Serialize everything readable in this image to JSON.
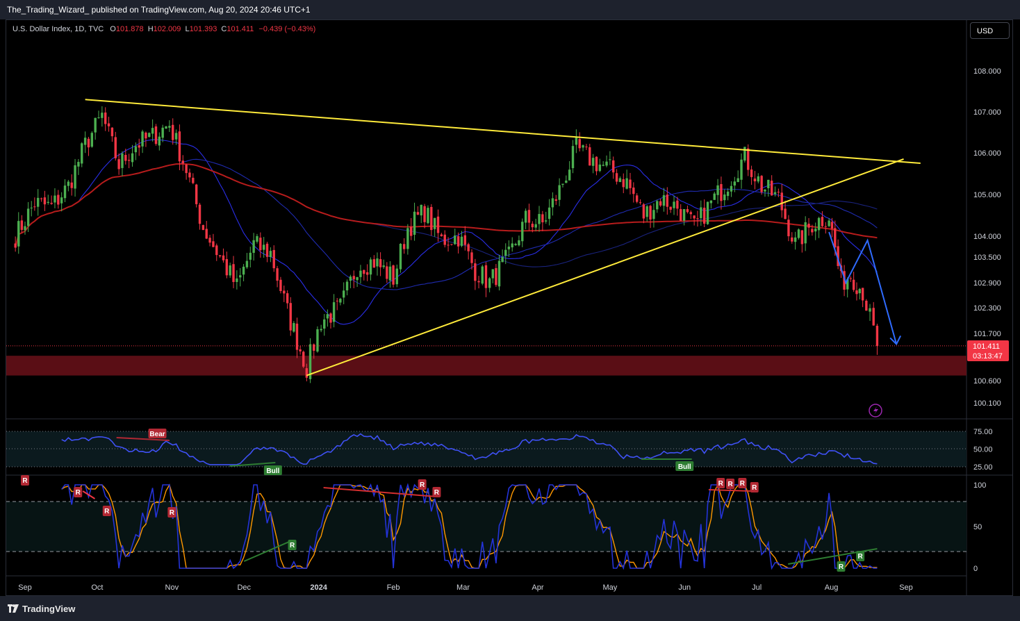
{
  "header": {
    "publisher": "The_Trading_Wizard_ published on TradingView.com, Aug 20, 2024 20:46 UTC+1"
  },
  "legend": {
    "symbol": "U.S. Dollar Index, 1D, TVC",
    "o_label": "O",
    "o_value": "101.878",
    "h_label": "H",
    "h_value": "102.009",
    "l_label": "L",
    "l_value": "101.393",
    "c_label": "C",
    "c_value": "101.411",
    "change": "−0.439 (−0.43%)"
  },
  "currency_button": "USD",
  "footer": {
    "logo_text": "TradingView"
  },
  "colors": {
    "up": "#4caf50",
    "down": "#f23645",
    "trendline": "#ffeb3b",
    "ma_red": "#b71c1c",
    "ma_blue": "#2a2ee8",
    "projection": "#2962ff",
    "zone": "#5a0e15",
    "rsi": "#3f51f5",
    "stoch_k": "#2433d8",
    "stoch_d": "#ff9800"
  },
  "chart_data": [
    {
      "type": "candlestick",
      "title": "U.S. Dollar Index, 1D, TVC",
      "x_labels": [
        "Sep",
        "Oct",
        "Nov",
        "Dec",
        "2024",
        "Feb",
        "Mar",
        "Apr",
        "May",
        "Jun",
        "Jul",
        "Aug",
        "Sep"
      ],
      "y_ticks": [
        "108.000",
        "107.000",
        "106.000",
        "105.000",
        "104.000",
        "103.500",
        "102.900",
        "102.300",
        "101.700",
        "100.600",
        "100.100"
      ],
      "last_price": "101.411",
      "countdown": "03:13:47",
      "close_path": [
        [
          "2023-08-28",
          104.0
        ],
        [
          "2023-09-05",
          104.8
        ],
        [
          "2023-09-12",
          104.7
        ],
        [
          "2023-09-19",
          105.2
        ],
        [
          "2023-09-26",
          106.2
        ],
        [
          "2023-10-03",
          106.9
        ],
        [
          "2023-10-10",
          105.7
        ],
        [
          "2023-10-17",
          106.2
        ],
        [
          "2023-10-24",
          106.4
        ],
        [
          "2023-10-31",
          106.7
        ],
        [
          "2023-11-07",
          105.6
        ],
        [
          "2023-11-14",
          104.2
        ],
        [
          "2023-11-21",
          103.5
        ],
        [
          "2023-11-28",
          102.8
        ],
        [
          "2023-12-05",
          103.8
        ],
        [
          "2023-12-12",
          103.6
        ],
        [
          "2023-12-19",
          102.2
        ],
        [
          "2023-12-27",
          100.9
        ],
        [
          "2024-01-02",
          102.0
        ],
        [
          "2024-01-10",
          102.3
        ],
        [
          "2024-01-17",
          103.3
        ],
        [
          "2024-01-24",
          103.4
        ],
        [
          "2024-02-01",
          103.0
        ],
        [
          "2024-02-07",
          104.2
        ],
        [
          "2024-02-14",
          104.6
        ],
        [
          "2024-02-21",
          103.9
        ],
        [
          "2024-02-28",
          104.0
        ],
        [
          "2024-03-06",
          103.2
        ],
        [
          "2024-03-12",
          102.9
        ],
        [
          "2024-03-20",
          103.5
        ],
        [
          "2024-03-27",
          104.4
        ],
        [
          "2024-04-03",
          104.3
        ],
        [
          "2024-04-10",
          105.1
        ],
        [
          "2024-04-17",
          106.1
        ],
        [
          "2024-04-24",
          105.8
        ],
        [
          "2024-05-01",
          105.6
        ],
        [
          "2024-05-08",
          105.3
        ],
        [
          "2024-05-15",
          104.5
        ],
        [
          "2024-05-22",
          104.9
        ],
        [
          "2024-05-29",
          104.7
        ],
        [
          "2024-06-05",
          104.2
        ],
        [
          "2024-06-12",
          104.8
        ],
        [
          "2024-06-19",
          105.3
        ],
        [
          "2024-06-26",
          105.9
        ],
        [
          "2024-07-03",
          105.2
        ],
        [
          "2024-07-10",
          104.9
        ],
        [
          "2024-07-17",
          103.8
        ],
        [
          "2024-07-24",
          104.3
        ],
        [
          "2024-07-31",
          104.5
        ],
        [
          "2024-08-05",
          102.9
        ],
        [
          "2024-08-09",
          103.1
        ],
        [
          "2024-08-14",
          102.7
        ],
        [
          "2024-08-20",
          101.411
        ]
      ],
      "trendlines": [
        {
          "from": [
            "2023-09-26",
            107.3
          ],
          "to": [
            "2024-09-07",
            105.75
          ]
        },
        {
          "from": [
            "2023-12-27",
            100.72
          ],
          "to": [
            "2024-08-31",
            105.85
          ]
        }
      ],
      "support_zone": [
        100.72,
        101.18
      ],
      "projection_path": [
        [
          "2024-07-31",
          104.1
        ],
        [
          "2024-08-07",
          102.9
        ],
        [
          "2024-08-16",
          103.9
        ],
        [
          "2024-08-28",
          101.45
        ]
      ]
    },
    {
      "type": "line",
      "indicator": "RSI",
      "y_ticks": [
        "75.00",
        "50.00",
        "25.00"
      ],
      "annotations": [
        "Bear",
        "Bull",
        "Bull"
      ]
    },
    {
      "type": "line",
      "indicator": "Stochastic",
      "y_ticks": [
        "100",
        "50",
        "0"
      ],
      "labels": [
        "R",
        "R",
        "R",
        "R",
        "R",
        "R",
        "R",
        "R",
        "R",
        "R",
        "R",
        "R",
        "R",
        "R"
      ]
    }
  ]
}
